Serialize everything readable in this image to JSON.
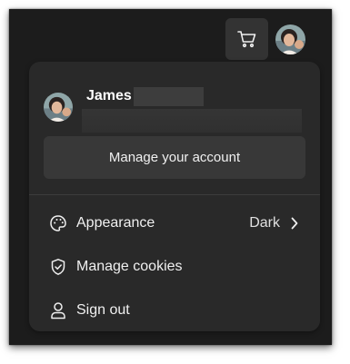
{
  "header": {
    "cart_icon": "cart-icon",
    "avatar_icon": "avatar"
  },
  "account_menu": {
    "user_name": "James",
    "manage_account_label": "Manage your account",
    "items": [
      {
        "label": "Appearance",
        "value": "Dark",
        "icon": "palette-icon",
        "has_chevron": true
      },
      {
        "label": "Manage cookies",
        "icon": "shield-check-icon"
      },
      {
        "label": "Sign out",
        "icon": "person-icon"
      }
    ]
  },
  "colors": {
    "window_bg": "#1c1c1c",
    "panel_bg": "#292929",
    "button_bg": "#383838",
    "text": "#f0f0f0"
  }
}
